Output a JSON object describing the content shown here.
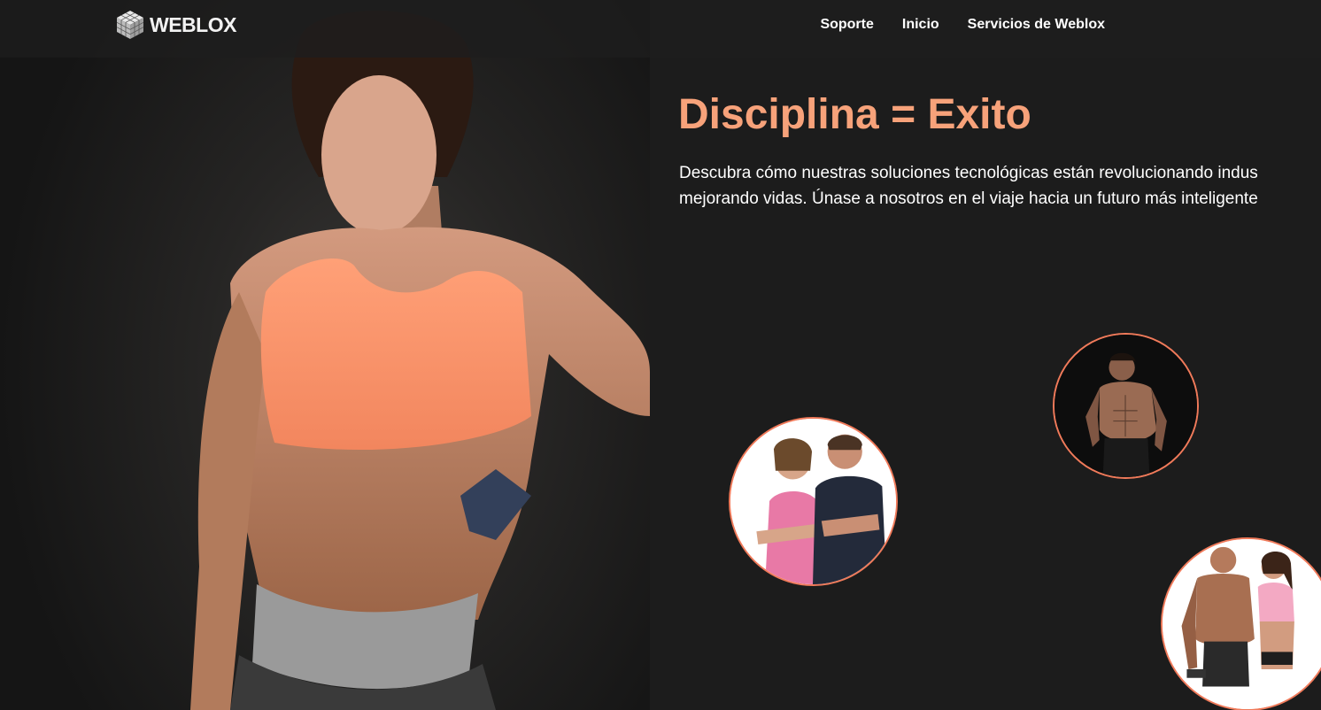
{
  "nav": {
    "logo_text": "WEBLOX",
    "logo_icon": "cube-logo-icon",
    "links": [
      "Soporte",
      "Inicio",
      "Servicios de Weblox"
    ]
  },
  "hero": {
    "headline": "Disciplina = Exito",
    "intro_line1": "Descubra cómo nuestras soluciones tecnológicas están revolucionando indus",
    "intro_line2": "mejorando vidas. Únase a nosotros en el viaje hacia un futuro más inteligente"
  },
  "colors": {
    "accent": "#f7a27a",
    "circle_border": "#f07a5a",
    "background": "#1c1c1c",
    "nav_text": "#ffffff"
  }
}
